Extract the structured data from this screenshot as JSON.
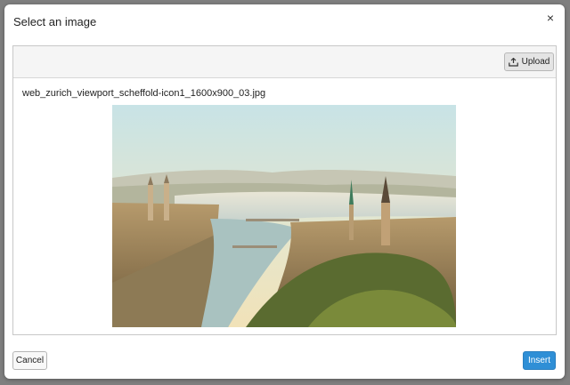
{
  "dialog": {
    "title": "Select an image",
    "close_icon": "×"
  },
  "toolbar": {
    "upload_label": "Upload",
    "upload_icon": "upload-tray-icon"
  },
  "image": {
    "filename": "web_zurich_viewport_scheffold-icon1_1600x900_03.jpg"
  },
  "footer": {
    "cancel_label": "Cancel",
    "insert_label": "Insert"
  },
  "colors": {
    "backdrop": "#7f7f7f",
    "primary": "#2f8fd6"
  }
}
